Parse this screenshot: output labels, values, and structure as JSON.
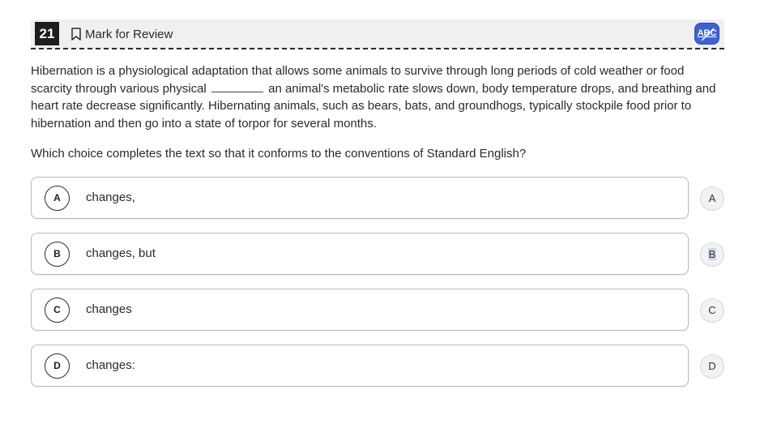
{
  "header": {
    "question_number": "21",
    "mark_for_review_label": "Mark for Review",
    "abc_label": "ABC"
  },
  "passage": {
    "before_blank": "Hibernation is a physiological adaptation that allows some animals to survive through long periods of cold weather or food scarcity through various physical",
    "after_blank": "an animal's metabolic rate slows down, body temperature drops, and breathing and heart rate decrease significantly. Hibernating animals, such as bears, bats, and groundhogs, typically stockpile food prior to hibernation and then go into a state of torpor for several months."
  },
  "question": "Which choice completes the text so that it conforms to the conventions of Standard English?",
  "choices": [
    {
      "letter": "A",
      "text": "changes,"
    },
    {
      "letter": "B",
      "text": "changes, but"
    },
    {
      "letter": "C",
      "text": "changes"
    },
    {
      "letter": "D",
      "text": "changes:"
    }
  ],
  "eliminators": [
    {
      "letter": "A"
    },
    {
      "letter": "B"
    },
    {
      "letter": "C"
    },
    {
      "letter": "D"
    }
  ],
  "colors": {
    "abc_button": "#3b62d8",
    "question_badge": "#1e1e1e",
    "header_bg": "#f0f0f0"
  }
}
